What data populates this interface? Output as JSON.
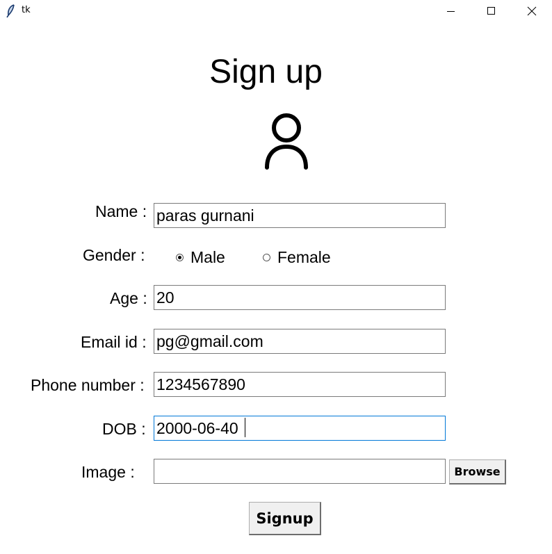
{
  "window": {
    "title": "tk"
  },
  "form": {
    "heading": "Sign up",
    "avatar_icon": "user-avatar-icon",
    "fields": {
      "name": {
        "label": "Name :",
        "value": "paras gurnani"
      },
      "gender": {
        "label": "Gender :",
        "options": [
          "Male",
          "Female"
        ],
        "selected": "Male"
      },
      "age": {
        "label": "Age :",
        "value": "20"
      },
      "email": {
        "label": "Email id :",
        "value": "pg@gmail.com"
      },
      "phone": {
        "label": "Phone number :",
        "value": "1234567890"
      },
      "dob": {
        "label": "DOB :",
        "value": "2000-06-40"
      },
      "image": {
        "label": "Image :",
        "value": ""
      }
    },
    "browse_label": "Browse",
    "signup_label": "Signup"
  }
}
